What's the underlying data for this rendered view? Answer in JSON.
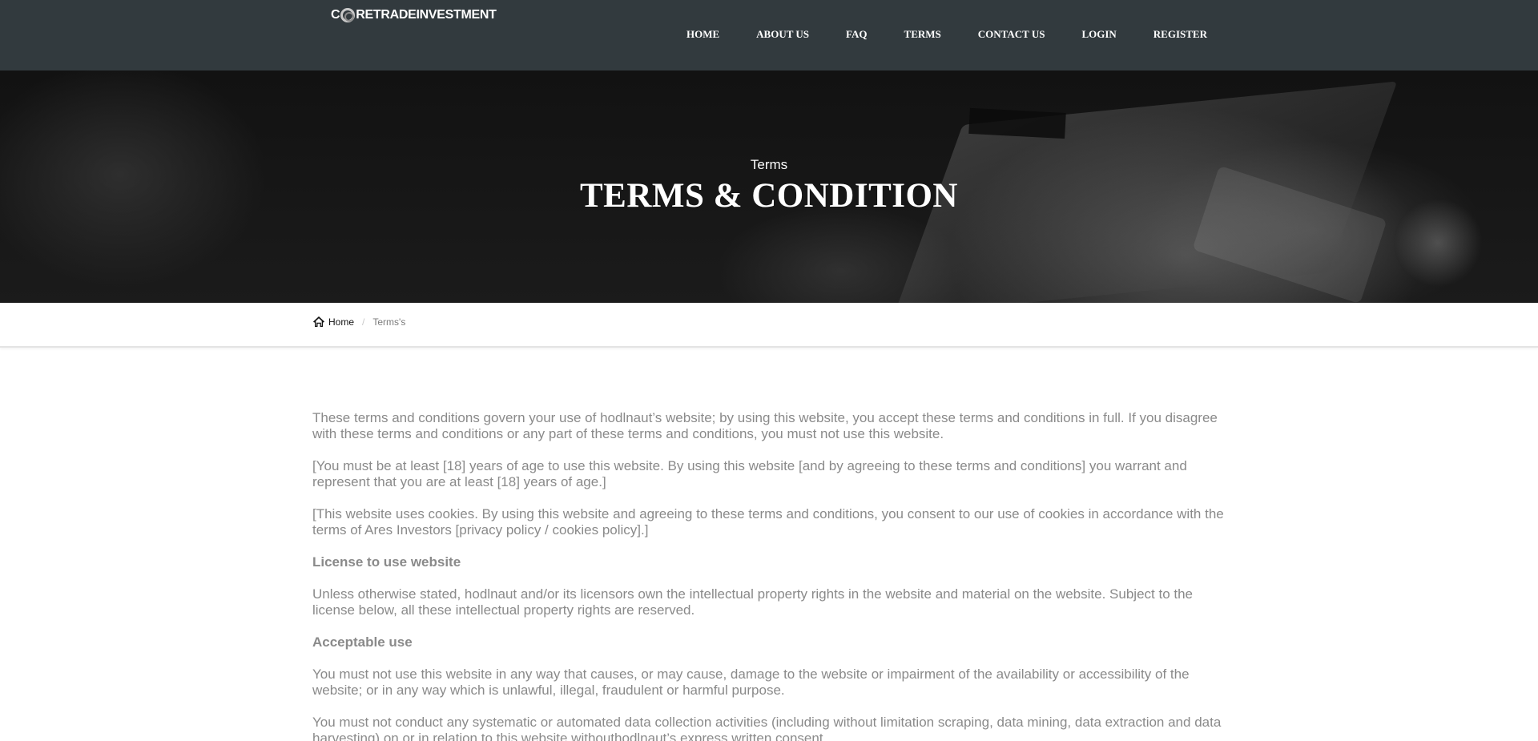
{
  "brand": {
    "name": "RETRADEINVESTMENT",
    "logo_prefix": "C"
  },
  "nav": {
    "items": [
      {
        "label": "HOME"
      },
      {
        "label": "ABOUT US"
      },
      {
        "label": "FAQ"
      },
      {
        "label": "TERMS"
      },
      {
        "label": "CONTACT US"
      },
      {
        "label": "LOGIN"
      },
      {
        "label": "REGISTER"
      }
    ]
  },
  "hero": {
    "subtitle": "Terms",
    "title": "TERMS & CONDITION"
  },
  "breadcrumb": {
    "home_icon": "home-icon",
    "home_label": "Home",
    "separator": "/",
    "current": "Terms's"
  },
  "content": {
    "p1": "These terms and conditions govern your use of hodlnaut’s website; by using this website, you accept these terms and conditions in full. If you disagree with these terms and conditions or any part of these terms and conditions, you must not use this website.",
    "p2": "[You must be at least [18] years of age to use this website. By using this website [and by agreeing to these terms and conditions] you warrant and represent that you are at least [18] years of age.]",
    "p3": "[This website uses cookies. By using this website and agreeing to these terms and conditions, you consent to our use of cookies in accordance with the terms of Ares Investors [privacy policy / cookies policy].]",
    "h1": "License to use website",
    "p4": "Unless otherwise stated, hodlnaut and/or its licensors own the intellectual property rights in the website and material on the website. Subject to the license below, all these intellectual property rights are reserved.",
    "h2": "Acceptable use",
    "p5": "You must not use this website in any way that causes, or may cause, damage to the website or impairment of the availability or accessibility of the website; or in any way which is unlawful, illegal, fraudulent or harmful purpose.",
    "p6": "You must not conduct any systematic or automated data collection activities (including without limitation scraping, data mining, data extraction and data harvesting) on or in relation to this website withouthodlnaut’s express written consent."
  },
  "colors": {
    "topbar": "#323a3e",
    "body_text": "#8a8a8a",
    "hero_text": "#ffffff"
  }
}
